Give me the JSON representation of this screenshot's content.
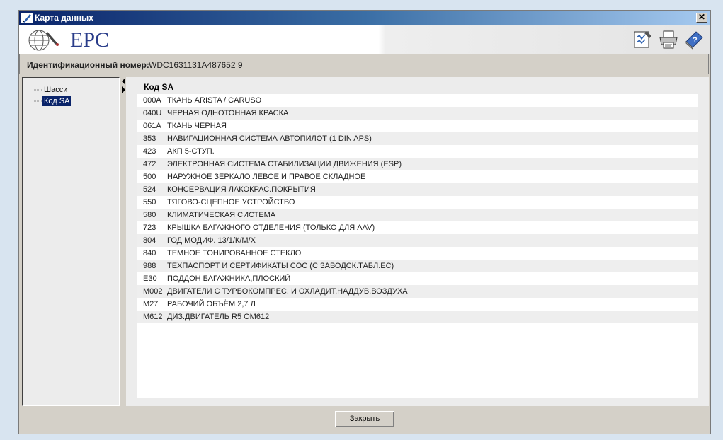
{
  "window": {
    "title": "Карта данных",
    "close_glyph": "✕"
  },
  "banner": {
    "logo_text": "EPC",
    "icons": [
      "report-icon",
      "print-icon",
      "help-book-icon"
    ]
  },
  "idbar": {
    "label": "Идентификационный номер:",
    "value": "WDC1631131A487652 9"
  },
  "tree": {
    "items": [
      {
        "label": "Шасси"
      },
      {
        "label": "Код SA"
      }
    ]
  },
  "list": {
    "header": "Код SA",
    "rows": [
      {
        "code": "000A",
        "desc": "ТКАНЬ ARISTA / CARUSO"
      },
      {
        "code": "040U",
        "desc": "ЧЕРНАЯ ОДНОТОННАЯ КРАСКА"
      },
      {
        "code": "061A",
        "desc": "ТКАНЬ ЧЕРНАЯ"
      },
      {
        "code": "353",
        "desc": "НАВИГАЦИОННАЯ СИСТЕМА АВТОПИЛОТ (1 DIN APS)"
      },
      {
        "code": "423",
        "desc": "АКП 5-СТУП."
      },
      {
        "code": "472",
        "desc": "ЭЛЕКТРОННАЯ СИСТЕМА СТАБИЛИЗАЦИИ ДВИЖЕНИЯ (ESP)"
      },
      {
        "code": "500",
        "desc": "НАРУЖНОЕ ЗЕРКАЛО ЛЕВОЕ И ПРАВОЕ СКЛАДНОЕ"
      },
      {
        "code": "524",
        "desc": "КОНСЕРВАЦИЯ ЛАКОКРАС.ПОКРЫТИЯ"
      },
      {
        "code": "550",
        "desc": "ТЯГОВО-СЦЕПНОЕ УСТРОЙСТВО"
      },
      {
        "code": "580",
        "desc": "КЛИМАТИЧЕСКАЯ СИСТЕМА"
      },
      {
        "code": "723",
        "desc": "КРЫШКА БАГАЖНОГО ОТДЕЛЕНИЯ (ТОЛЬКО ДЛЯ AAV)"
      },
      {
        "code": "804",
        "desc": "ГОД МОДИФ. 13/1/К/М/Х"
      },
      {
        "code": "840",
        "desc": "ТЕМНОЕ ТОНИРОВАННОЕ СТЕКЛО"
      },
      {
        "code": "988",
        "desc": "ТЕХПАСПОРТ И СЕРТИФИКАТЫ COC (С ЗАВОДСК.ТАБЛ.EC)"
      },
      {
        "code": "E30",
        "desc": "ПОДДОН БАГАЖНИКА,ПЛОСКИЙ"
      },
      {
        "code": "M002",
        "desc": "ДВИГАТЕЛИ С ТУРБОКОМПРЕС. И ОХЛАДИТ.НАДДУВ.ВОЗДУХА"
      },
      {
        "code": "M27",
        "desc": "РАБОЧИЙ ОБЪЁМ 2,7 Л"
      },
      {
        "code": "M612",
        "desc": "ДИЗ.ДВИГАТЕЛЬ R5 OM612"
      }
    ]
  },
  "footer": {
    "close_label": "Закрыть"
  },
  "colors": {
    "title_start": "#0a246a",
    "title_end": "#a6caf0",
    "logo": "#2a3d8a",
    "selection": "#0a246a"
  }
}
